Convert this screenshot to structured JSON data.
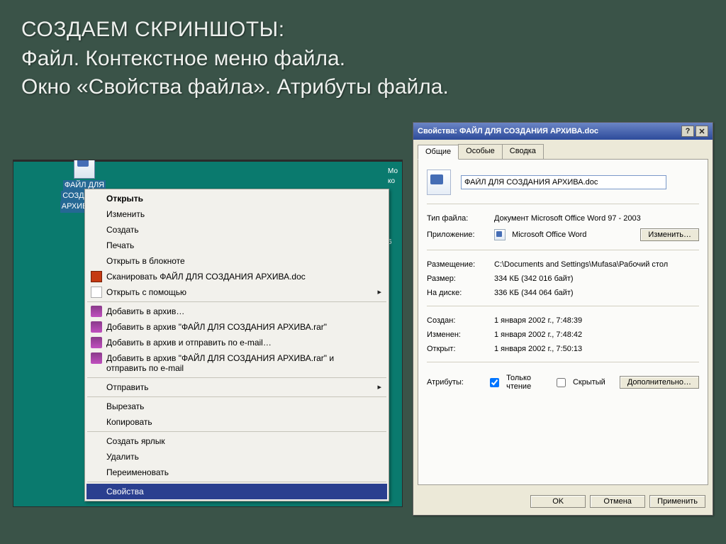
{
  "slide": {
    "line1": "Создаем скриншоты:",
    "line2": "Файл. Контекстное меню файла.",
    "line3": "Окно «Свойства файла». Атрибуты файла."
  },
  "desktop": {
    "file_label_1": "ФАЙЛ ДЛЯ",
    "file_label_2": "СОЗДАНИЯ",
    "file_label_3": "АРХИВА.doc",
    "cut_text_1": "Мо",
    "cut_text_2": "ко",
    "cut_text_3": "6"
  },
  "menu": {
    "open": "Открыть",
    "edit": "Изменить",
    "new": "Создать",
    "print": "Печать",
    "open_in_notepad": "Открыть в блокноте",
    "scan": "Сканировать ФАЙЛ ДЛЯ СОЗДАНИЯ АРХИВА.doc",
    "open_with": "Открыть с помощью",
    "add_archive": "Добавить в архив…",
    "add_archive_named": "Добавить в архив \"ФАЙЛ ДЛЯ СОЗДАНИЯ АРХИВА.rar\"",
    "add_email": "Добавить в архив и отправить по e-mail…",
    "add_named_email": "Добавить в архив \"ФАЙЛ ДЛЯ СОЗДАНИЯ АРХИВА.rar\" и отправить по e-mail",
    "send_to": "Отправить",
    "cut": "Вырезать",
    "copy": "Копировать",
    "create_shortcut": "Создать ярлык",
    "delete": "Удалить",
    "rename": "Переименовать",
    "properties": "Свойства"
  },
  "dialog": {
    "title": "Свойства: ФАЙЛ ДЛЯ СОЗДАНИЯ АРХИВА.doc",
    "tabs": {
      "general": "Общие",
      "special": "Особые",
      "summary": "Сводка"
    },
    "filename": "ФАЙЛ ДЛЯ СОЗДАНИЯ АРХИВА.doc",
    "labels": {
      "filetype": "Тип файла:",
      "app": "Приложение:",
      "location": "Размещение:",
      "size": "Размер:",
      "ondisk": "На диске:",
      "created": "Создан:",
      "modified": "Изменен:",
      "accessed": "Открыт:",
      "attributes": "Атрибуты:"
    },
    "values": {
      "filetype": "Документ Microsoft Office Word 97 - 2003",
      "app": "Microsoft Office Word",
      "location": "C:\\Documents and Settings\\Mufasa\\Рабочий стол",
      "size": "334 КБ (342 016 байт)",
      "ondisk": "336 КБ (344 064 байт)",
      "created": "1 января 2002 г., 7:48:39",
      "modified": "1 января 2002 г., 7:48:42",
      "accessed": "1 января 2002 г., 7:50:13"
    },
    "attr_readonly": "Только чтение",
    "attr_hidden": "Скрытый",
    "change_btn": "Изменить…",
    "advanced_btn": "Дополнительно…",
    "ok": "OK",
    "cancel": "Отмена",
    "apply": "Применить"
  }
}
